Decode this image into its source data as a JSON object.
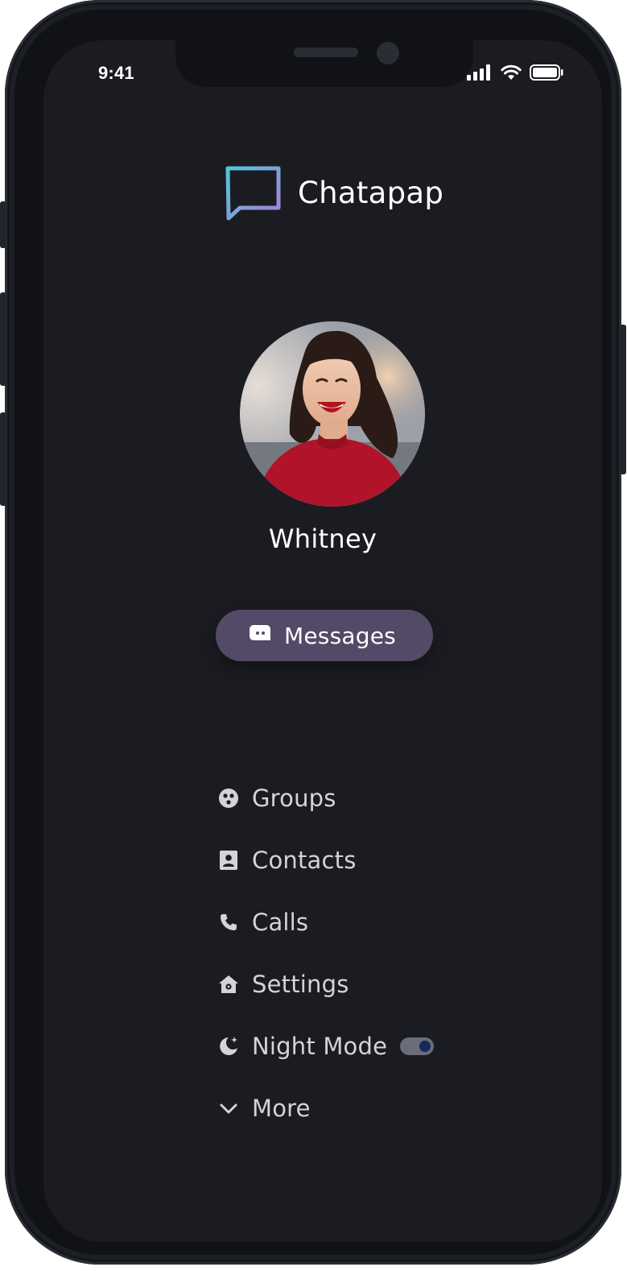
{
  "status_bar": {
    "time": "9:41"
  },
  "app": {
    "name": "Chatapap",
    "logo_gradient": [
      "#4fc7d6",
      "#a97ed6"
    ]
  },
  "profile": {
    "name": "Whitney"
  },
  "primary_action": {
    "label": "Messages",
    "icon": "chat-bubble-icon",
    "background": "#524a66"
  },
  "menu": {
    "items": [
      {
        "label": "Groups",
        "icon": "groups-icon"
      },
      {
        "label": "Contacts",
        "icon": "contacts-icon"
      },
      {
        "label": "Calls",
        "icon": "phone-icon"
      },
      {
        "label": "Settings",
        "icon": "home-settings-icon"
      },
      {
        "label": "Night Mode",
        "icon": "moon-icon",
        "toggle": "on"
      },
      {
        "label": "More",
        "icon": "chevron-down-icon"
      }
    ]
  },
  "colors": {
    "screen_bg": "#1b1c22",
    "menu_text": "#d3d4da",
    "toggle_knob": "#142a5c"
  }
}
